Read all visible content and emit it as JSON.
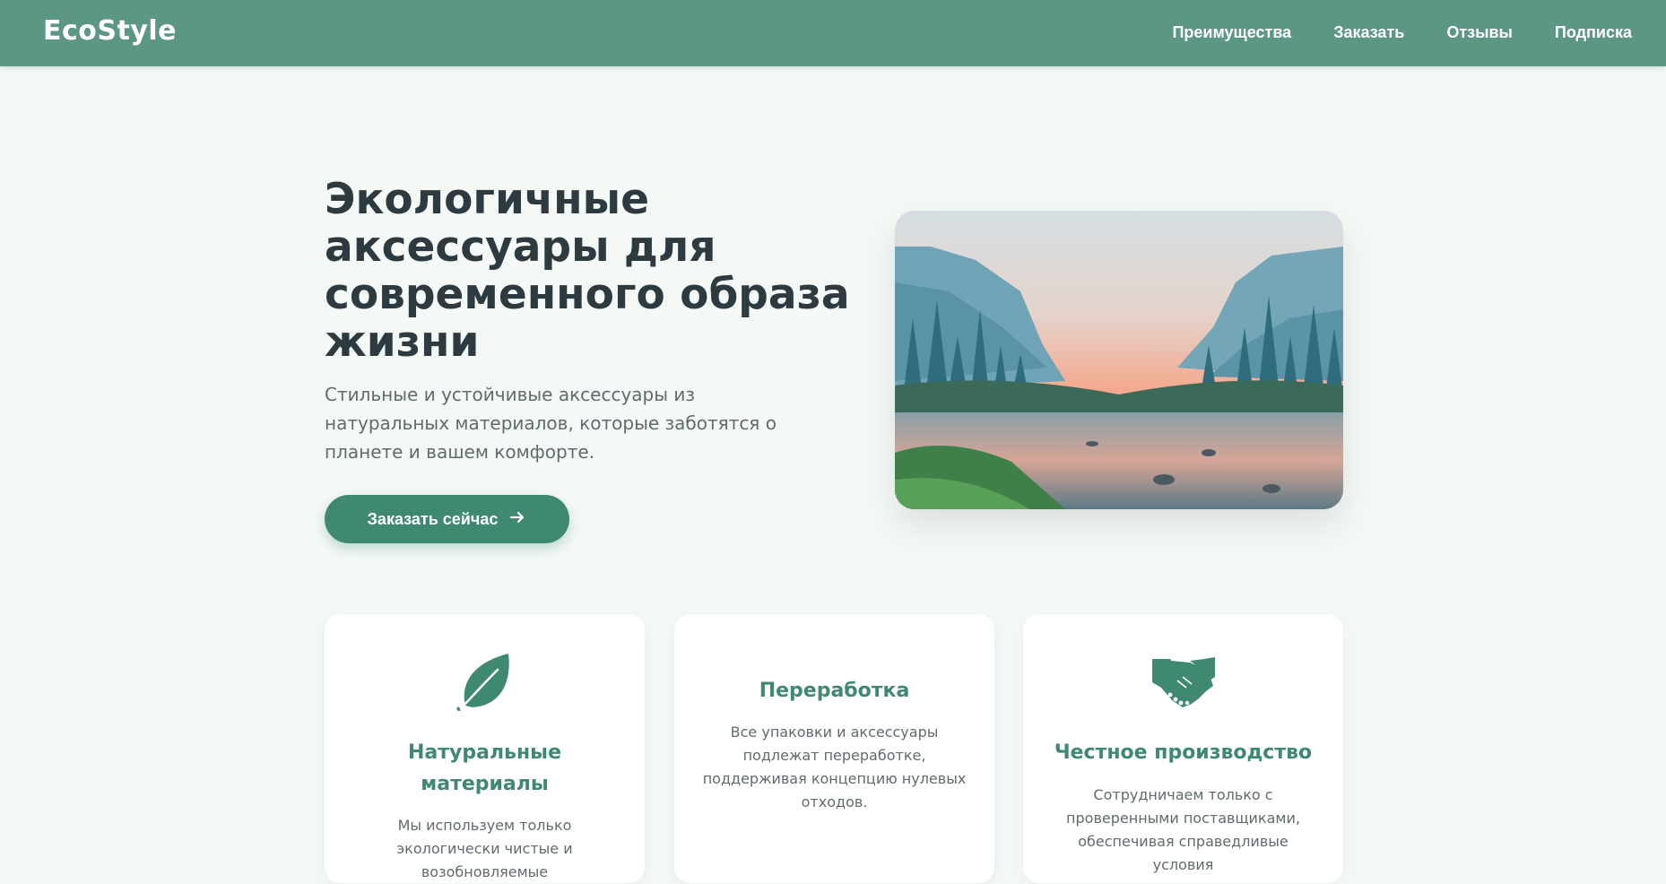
{
  "header": {
    "logo": "EcoStyle",
    "nav": [
      {
        "label": "Преимущества"
      },
      {
        "label": "Заказать"
      },
      {
        "label": "Отзывы"
      },
      {
        "label": "Подписка"
      }
    ]
  },
  "hero": {
    "title": "Экологичные аксессуары для современного образа жизни",
    "subtitle": "Стильные и устойчивые аксессуары из натуральных материалов, которые заботятся о планете и вашем комфорте.",
    "cta_label": "Заказать сейчас",
    "image_icon": "landscape-photo"
  },
  "features": [
    {
      "icon": "leaf-icon",
      "title": "Натуральные материалы",
      "text": "Мы используем только экологически чистые и возобновляемые"
    },
    {
      "icon": "recycle-icon",
      "title": "Переработка",
      "text": "Все упаковки и аксессуары подлежат переработке, поддерживая концепцию нулевых отходов."
    },
    {
      "icon": "handshake-icon",
      "title": "Честное производство",
      "text": "Сотрудничаем только с проверенными поставщиками, обеспечивая справедливые условия"
    }
  ],
  "colors": {
    "header_bg": "#5b9782",
    "accent": "#3f8a6f",
    "page_bg": "#f4f9f6",
    "heading": "#2d3a40"
  }
}
